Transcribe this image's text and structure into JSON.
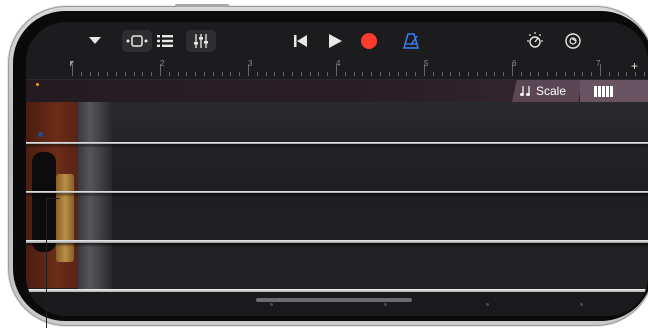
{
  "toolbar": {
    "left_icons": [
      "dropdown-icon",
      "track-view-icon",
      "list-view-icon",
      "mixer-icon"
    ],
    "transport_icons": [
      "rewind-icon",
      "play-icon",
      "record-icon",
      "metronome-icon"
    ],
    "right_icons": [
      "master-volume-icon",
      "settings-icon"
    ]
  },
  "ruler": {
    "bars": [
      "2",
      "3",
      "4",
      "5",
      "6",
      "7"
    ],
    "add_label": "+"
  },
  "controls": {
    "scale_label": "Scale",
    "scale_icon": "music-notes-icon",
    "keys_icon": "keyboard-icon"
  },
  "instrument": {
    "type": "strings",
    "string_count": 4
  },
  "colors": {
    "record": "#ff3b30",
    "metronome": "#3a82f7",
    "scale_bg": "#5a4753",
    "keys_bg": "#6a5462"
  }
}
